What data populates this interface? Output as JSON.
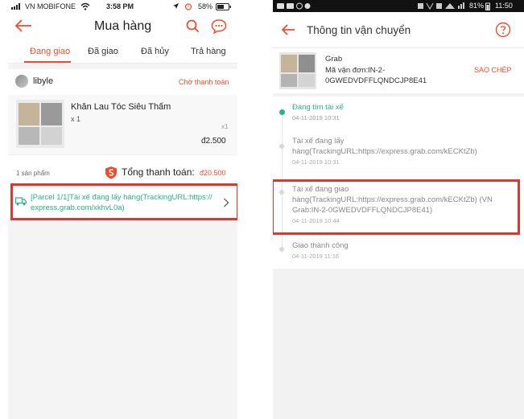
{
  "left": {
    "status_bar": {
      "carrier": "VN MOBIFONE",
      "time": "3:58 PM",
      "battery": "58%"
    },
    "header": {
      "title": "Mua hàng"
    },
    "tabs": [
      {
        "label": "Đang giao",
        "active": true
      },
      {
        "label": "Đã giao",
        "active": false
      },
      {
        "label": "Đã hủy",
        "active": false
      },
      {
        "label": "Trả hàng",
        "active": false
      }
    ],
    "shop": {
      "name": "libyle",
      "status": "Chờ thanh toán"
    },
    "product": {
      "name": "Khăn Lau Tóc Siêu Thấm",
      "qty_label": "x 1",
      "qty_right": "x1",
      "price": "đ2.500"
    },
    "summary": {
      "count": "1 sản phẩm",
      "total_label": "Tổng thanh toán:",
      "total_value": "đ20.500"
    },
    "tracking": {
      "line1": "[Parcel 1/1]Tài xế đang lấy hàng(TrackingURL:https://",
      "line2": "express.grab.com/xkhvL0a)"
    }
  },
  "right": {
    "status_bar": {
      "battery": "81%",
      "time": "11:50"
    },
    "header": {
      "title": "Thông tin vận chuyển"
    },
    "carrier": {
      "name": "Grab",
      "waybill_label": "Mã vận đơn:",
      "waybill_line1": "IN-2-",
      "waybill_line2": "0GWEDVDFFLQNDCJP8E41",
      "copy_label": "SAO CHÉP"
    },
    "timeline": [
      {
        "lines": [
          "Đang tìm tài xế"
        ],
        "time": "04-11-2019 10:31",
        "active": true
      },
      {
        "lines": [
          "Tài xế đang lấy",
          "hàng(TrackingURL:https://express.grab.com/kECKtZb)"
        ],
        "time": "04-11-2019 10:31",
        "active": false
      },
      {
        "lines": [
          "Tài xế đang giao",
          "hàng(TrackingURL:https://express.grab.com/kECKtZb) (VN",
          "Grab:IN-2-0GWEDVDFFLQNDCJP8E41)"
        ],
        "time": "04-11-2019 10:44",
        "active": false
      },
      {
        "lines": [
          "Giao thành công"
        ],
        "time": "04-11-2019 11:16",
        "active": false
      }
    ]
  },
  "colors": {
    "accent": "#ee4d2d",
    "highlight": "#e8322a",
    "teal": "#27b383"
  }
}
